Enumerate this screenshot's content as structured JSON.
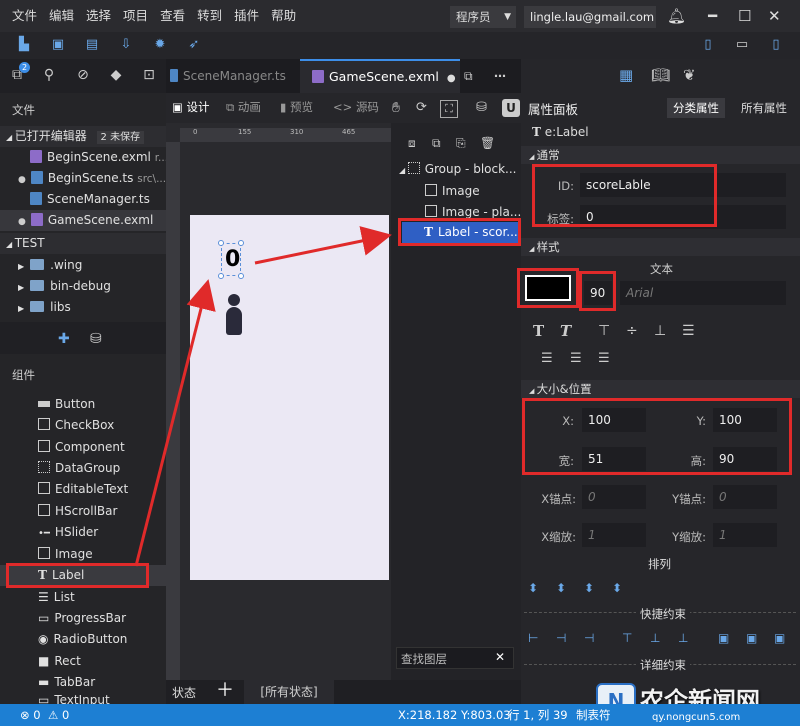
{
  "menubar": {
    "items": [
      "文件",
      "编辑",
      "选择",
      "项目",
      "查看",
      "转到",
      "插件",
      "帮助"
    ],
    "role": "程序员",
    "email": "lingle.lau@gmail.com"
  },
  "sidebar": {
    "badge_count": "2",
    "files_title": "文件",
    "open_editors": "已打开编辑器",
    "unsaved_badge": "2 未保存",
    "open_files": [
      {
        "name": "BeginScene.exml",
        "hint": "r...",
        "type": "exml",
        "dot": false
      },
      {
        "name": "BeginScene.ts",
        "hint": "src\\...",
        "type": "ts",
        "dot": true
      },
      {
        "name": "SceneManager.ts",
        "hint": "",
        "type": "ts",
        "dot": false
      },
      {
        "name": "GameScene.exml",
        "hint": "",
        "type": "exml",
        "dot": true
      }
    ],
    "project": "TEST",
    "folders": [
      ".wing",
      "bin-debug",
      "libs"
    ],
    "components_title": "组件",
    "components": [
      "Button",
      "CheckBox",
      "Component",
      "DataGroup",
      "EditableText",
      "HScrollBar",
      "HSlider",
      "Image",
      "Label",
      "List",
      "ProgressBar",
      "RadioButton",
      "Rect",
      "TabBar",
      "TextInput"
    ]
  },
  "tabs": {
    "inactive": "SceneManager.ts",
    "active": "GameScene.exml"
  },
  "designbar": {
    "design": "设计",
    "animation": "动画",
    "preview": "预览",
    "source": "源码"
  },
  "ruler": [
    "0",
    "155",
    "310",
    "465"
  ],
  "layers": {
    "items": [
      "Group - block...",
      "Image",
      "Image - pla...",
      "Label - scor..."
    ],
    "search_placeholder": "查找图层"
  },
  "bottombar": {
    "state": "状态",
    "all_states": "[所有状态]"
  },
  "props": {
    "title": "属性面板",
    "tab_category": "分类属性",
    "tab_all": "所有属性",
    "element": "e:Label",
    "sec_general": "通常",
    "id_label": "ID:",
    "id_value": "scoreLable",
    "tag_label": "标签:",
    "tag_value": "0",
    "sec_style": "样式",
    "text_title": "文本",
    "text_color": "#000000",
    "font_size": "90",
    "font_family": "Arial",
    "sec_size": "大小&位置",
    "x_label": "X:",
    "x_value": "100",
    "y_label": "Y:",
    "y_value": "100",
    "w_label": "宽:",
    "w_value": "51",
    "h_label": "高:",
    "h_value": "90",
    "ax_label": "X锚点:",
    "ax_value": "0",
    "ay_label": "Y锚点:",
    "ay_value": "0",
    "sx_label": "X缩放:",
    "sx_value": "1",
    "sy_label": "Y缩放:",
    "sy_value": "1",
    "arrange": "排列",
    "quick_constraints": "快捷约束",
    "detail_constraints": "详细约束"
  },
  "status": {
    "errors": "0",
    "warnings": "0",
    "coords": "X:218.182 Y:803.03",
    "position": "行 1, 列 39",
    "tab_hint": "制表符"
  },
  "watermark": "农企新闻网",
  "watermark_url": "qy.nongcun5.com"
}
